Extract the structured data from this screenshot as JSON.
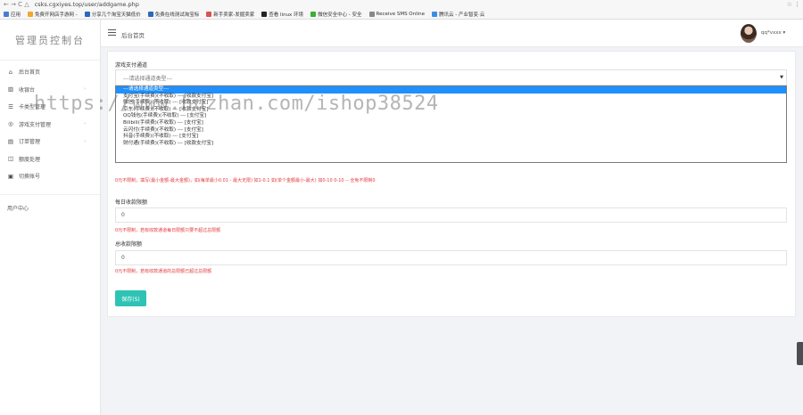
{
  "browser": {
    "nav_glyphs": "← → C △",
    "url": "csks.cgxiyes.top/user/addgame.php",
    "star": "☆",
    "menu": "⋮",
    "bookmarks": [
      {
        "label": "应用",
        "color": "#4a7bd0"
      },
      {
        "label": "免费开网店手游网 -",
        "color": "#f0a830"
      },
      {
        "label": "分享几个淘宝天猫低价",
        "color": "#2a6ab8"
      },
      {
        "label": "免费在线测试淘宝标",
        "color": "#2a6ab8"
      },
      {
        "label": "新手卖家-发掘卖家",
        "color": "#d9534f"
      },
      {
        "label": "查看 linux 环境",
        "color": "#222222"
      },
      {
        "label": "微信安全中心 - 安全",
        "color": "#3cb034"
      },
      {
        "label": "Receive SMS Online",
        "color": "#888888"
      },
      {
        "label": "腾讯云 - 产业智变·云",
        "color": "#3a8ee6"
      }
    ]
  },
  "sidebar": {
    "brand": "管理员控制台",
    "items": [
      {
        "icon": "home-icon",
        "glyph": "⌂",
        "label": "后台首页",
        "arrow": ""
      },
      {
        "icon": "bank-icon",
        "glyph": "▥",
        "label": "收银台",
        "arrow": "›"
      },
      {
        "icon": "list-icon",
        "glyph": "☰",
        "label": "卡类型管理",
        "arrow": ""
      },
      {
        "icon": "gamepad-icon",
        "glyph": "◎",
        "label": "游戏支付管理",
        "arrow": "›"
      },
      {
        "icon": "order-icon",
        "glyph": "▤",
        "label": "订单管理",
        "arrow": "›"
      },
      {
        "icon": "book-icon",
        "glyph": "◫",
        "label": "额度处理",
        "arrow": ""
      },
      {
        "icon": "lock-icon",
        "glyph": "▣",
        "label": "切换账号",
        "arrow": ""
      }
    ],
    "user_center": "用户中心"
  },
  "topbar": {
    "breadcrumb": "后台首页",
    "user_name": "qq*vxxx ▾"
  },
  "form": {
    "channel_label": "游戏支付通道",
    "channel_selected": "---请选择通道类型---",
    "options": [
      "---请选择通道类型---",
      "支付宝(手续费)(不收取) --- [收款支付宝]",
      "微信(手续费)(不收取) --- [收款支付宝]",
      "京东(手续费)(不收取) --- [收款支付宝]",
      "QQ钱包(手续费)(不收取) --- [支付宝]",
      "Bilibili(手续费)(不收取) --- [支付宝]",
      "云闪付(手续费)(不收取) --- [支付宝]",
      "抖音(手续费)(不收取) --- [支付宝]",
      "财付通(手续费)(不收取) --- [收款支付宝]"
    ],
    "channel_hint": "0元不限制，填写(最小金额-最大金额)，如(每单最小0.01 - 最大无限) 如1-0.1 如(单个金额最小-最大) 如0-10 0-10 -- 全免不限制0",
    "daily_label": "每日收款限额",
    "daily_value": "0",
    "daily_hint": "0元不限制，若有收款通道每日限额只要不超过总限额",
    "total_label": "总收款限额",
    "total_value": "0",
    "total_hint": "0元不限制，若有收款通道的总限额已超过总限额",
    "save_button": "保存(S)"
  },
  "watermark": "https://www.huzhan.com/ishop38524"
}
